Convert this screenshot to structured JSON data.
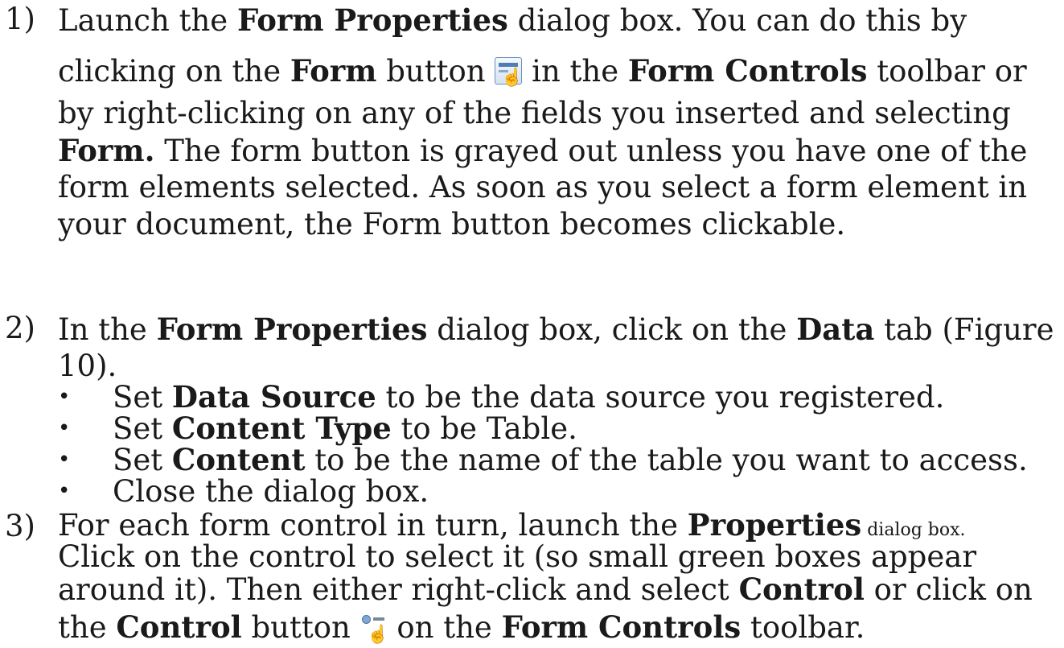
{
  "steps": [
    {
      "number": "1)",
      "lines": {
        "l1_a": "Launch the ",
        "l1_b": "Form Properties",
        "l1_c": " dialog box. You can do this by",
        "l2_a": "clicking on the ",
        "l2_b": "Form",
        "l2_c": " button ",
        "l2_d": " in the ",
        "l2_e": "Form Controls",
        "l2_f": " toolbar or",
        "l3": "by right-clicking on any of the fields you inserted and selecting",
        "l4_a": "Form.",
        "l4_b": " The form button is grayed out unless you have one of the",
        "l5": "form elements selected. As soon as you select a form element in",
        "l6": "your document, the Form button becomes clickable."
      }
    },
    {
      "number": "2)",
      "lines": {
        "l1_a": "In the ",
        "l1_b": "Form Properties",
        "l1_c": " dialog box, click on the ",
        "l1_d": "Data",
        "l1_e": " tab (Figure",
        "l2": "10)."
      },
      "bullets": [
        {
          "dot": "•",
          "pre": "Set ",
          "bold": "Data Source",
          "post": " to be the data source you registered."
        },
        {
          "dot": "•",
          "pre": "Set ",
          "bold": "Content Type",
          "post": " to be Table."
        },
        {
          "dot": "•",
          "pre": "Set ",
          "bold": "Content",
          "post": " to be the name of the table you want to access."
        },
        {
          "dot": "•",
          "pre": "Close the dialog box.",
          "bold": "",
          "post": ""
        }
      ]
    },
    {
      "number": "3)",
      "lines": {
        "l1_a": "For each form control in turn, launch the ",
        "l1_b": "Properties",
        "l1_c": " dialog box.",
        "l2": "Click on the control to select it (so small green boxes appear",
        "l3_a": "around it). Then either right-click and select ",
        "l3_b": "Control",
        "l3_c": " or click on",
        "l4_a": "the ",
        "l4_b": "Control",
        "l4_c": " button ",
        "l4_d": " on the ",
        "l4_e": "Form Controls",
        "l4_f": " toolbar."
      }
    }
  ],
  "icons": {
    "form_button": "form-icon",
    "control_button": "control-icon",
    "hand_glyph": "☝"
  },
  "colors": {
    "text": "#1a1a1a",
    "icon_blue": "#4f7db3"
  }
}
